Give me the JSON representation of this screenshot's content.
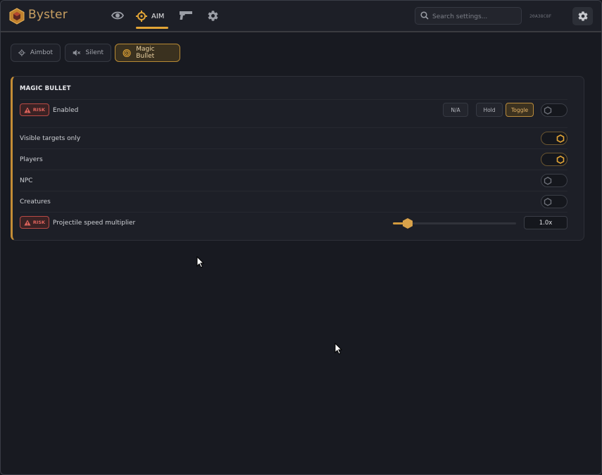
{
  "app": {
    "brand": "Byster",
    "hwid": "20A38C8F"
  },
  "nav": {
    "aim_label": "AIM",
    "icons": [
      "eye-icon",
      "crosshair-icon",
      "gun-icon",
      "gear-icon"
    ],
    "active": "AIM"
  },
  "search": {
    "placeholder": "Search settings...",
    "value": ""
  },
  "tabs": [
    {
      "label": "Aimbot",
      "icon": "crosshair-icon",
      "active": false
    },
    {
      "label": "Silent",
      "icon": "muted-speaker-icon",
      "active": false
    },
    {
      "label": "Magic Bullet",
      "icon": "target-icon",
      "active": true
    }
  ],
  "panel": {
    "title": "MAGIC BULLET",
    "risk_label": "RISK",
    "rows": [
      {
        "label": "Enabled",
        "risk": true,
        "keybind": "N/A",
        "modes": [
          "Hold",
          "Toggle"
        ],
        "active_mode": "Toggle",
        "toggle": false
      },
      {
        "label": "Visible targets only",
        "risk": false,
        "toggle": true
      },
      {
        "label": "Players",
        "risk": false,
        "toggle": true
      },
      {
        "label": "NPC",
        "risk": false,
        "toggle": false
      },
      {
        "label": "Creatures",
        "risk": false,
        "toggle": false
      },
      {
        "label": "Projectile speed multiplier",
        "risk": true,
        "slider_fraction": 0.12,
        "value": "1.0x"
      }
    ]
  },
  "colors": {
    "accent": "#e3a536",
    "risk": "#e0645d",
    "background": "#181a21",
    "panel": "#1d1f27"
  }
}
